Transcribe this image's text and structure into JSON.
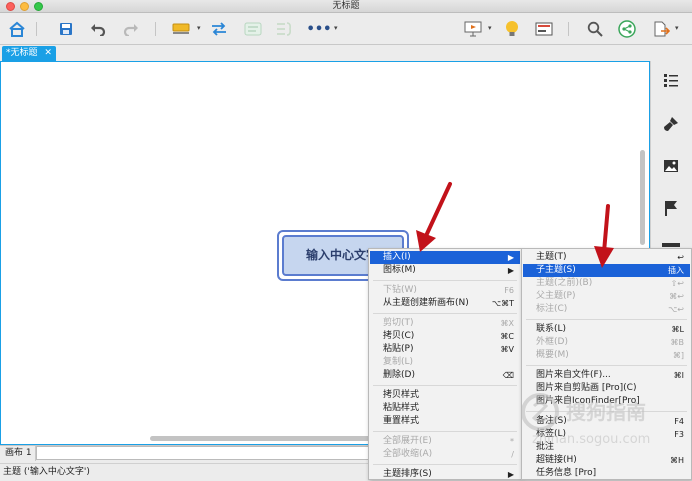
{
  "window": {
    "title": "无标题"
  },
  "colors": {
    "accent": "#1aa0e6",
    "highlight": "#1b62d8",
    "topic_fill": "#c6d6ef",
    "topic_border": "#5b7ccf",
    "annotation_arrow": "#c2121a"
  },
  "toolbar": {
    "icons": [
      "home-icon",
      "save-icon",
      "undo-icon",
      "redo-icon",
      "topic-style-icon",
      "relationship-icon",
      "boundary-icon",
      "summary-icon",
      "more-icon",
      "presentation-icon",
      "idea-bulb-icon",
      "outline-view-icon",
      "search-icon",
      "share-icon",
      "export-icon"
    ]
  },
  "tab": {
    "label": "*无标题",
    "close": "✕"
  },
  "topic": {
    "label": "输入中心文字"
  },
  "sheet": {
    "label": "画布 1"
  },
  "status": {
    "text": "主题 ('输入中心文字')"
  },
  "context_menu": {
    "items": [
      {
        "label": "插入(I)",
        "shortcut": "▶",
        "state": "highlight"
      },
      {
        "label": "图标(M)",
        "shortcut": "▶",
        "state": "normal"
      },
      {
        "sep": true
      },
      {
        "label": "下钻(W)",
        "shortcut": "F6",
        "state": "disabled"
      },
      {
        "label": "从主题创建新画布(N)",
        "shortcut": "⌥⌘T",
        "state": "normal"
      },
      {
        "sep": true
      },
      {
        "label": "剪切(T)",
        "shortcut": "⌘X",
        "state": "disabled"
      },
      {
        "label": "拷贝(C)",
        "shortcut": "⌘C",
        "state": "normal"
      },
      {
        "label": "粘贴(P)",
        "shortcut": "⌘V",
        "state": "normal"
      },
      {
        "label": "复制(L)",
        "shortcut": "",
        "state": "disabled"
      },
      {
        "label": "删除(D)",
        "shortcut": "⌫",
        "state": "normal"
      },
      {
        "sep": true
      },
      {
        "label": "拷贝样式",
        "shortcut": "",
        "state": "normal"
      },
      {
        "label": "粘贴样式",
        "shortcut": "",
        "state": "normal"
      },
      {
        "label": "重置样式",
        "shortcut": "",
        "state": "normal"
      },
      {
        "sep": true
      },
      {
        "label": "全部展开(E)",
        "shortcut": "*",
        "state": "disabled"
      },
      {
        "label": "全部收缩(A)",
        "shortcut": "/",
        "state": "disabled"
      },
      {
        "sep": true
      },
      {
        "label": "主题排序(S)",
        "shortcut": "▶",
        "state": "normal"
      }
    ]
  },
  "submenu": {
    "items": [
      {
        "label": "主题(T)",
        "shortcut": "↩",
        "state": "normal"
      },
      {
        "label": "子主题(S)",
        "shortcut": "插入",
        "state": "highlight"
      },
      {
        "label": "主题(之前)(B)",
        "shortcut": "⇧↩",
        "state": "disabled"
      },
      {
        "label": "父主题(P)",
        "shortcut": "⌘↩",
        "state": "disabled"
      },
      {
        "label": "标注(C)",
        "shortcut": "⌥↩",
        "state": "disabled"
      },
      {
        "sep": true
      },
      {
        "label": "联系(L)",
        "shortcut": "⌘L",
        "state": "normal"
      },
      {
        "label": "外框(D)",
        "shortcut": "⌘B",
        "state": "disabled"
      },
      {
        "label": "概要(M)",
        "shortcut": "⌘]",
        "state": "disabled"
      },
      {
        "sep": true
      },
      {
        "label": "图片来自文件(F)...",
        "shortcut": "⌘I",
        "state": "normal"
      },
      {
        "label": "图片来自剪贴画 [Pro](C)",
        "shortcut": "",
        "state": "normal"
      },
      {
        "label": "图片来自IconFinder[Pro]",
        "shortcut": "",
        "state": "normal"
      },
      {
        "sep": true
      },
      {
        "label": "备注(S)",
        "shortcut": "F4",
        "state": "normal"
      },
      {
        "label": "标签(L)",
        "shortcut": "F3",
        "state": "normal"
      },
      {
        "label": "批注",
        "shortcut": "",
        "state": "normal"
      },
      {
        "label": "超链接(H)",
        "shortcut": "⌘H",
        "state": "normal"
      },
      {
        "label": "任务信息 [Pro]",
        "shortcut": "",
        "state": "normal"
      }
    ]
  },
  "watermark": {
    "text": "搜狗指南",
    "url": "zhinan.sogou.com"
  }
}
